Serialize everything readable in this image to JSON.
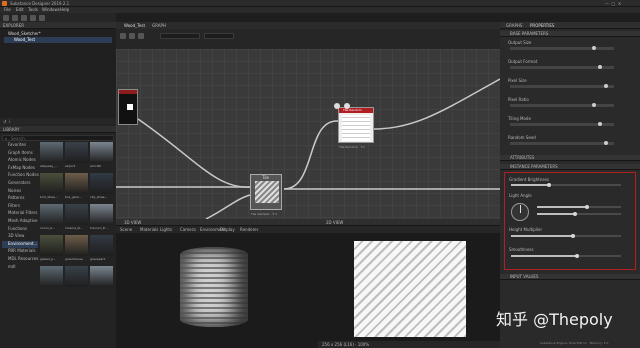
{
  "titlebar": {
    "title": "Substance Designer 2019.2.1"
  },
  "menubar": {
    "items": [
      "File",
      "Edit",
      "Tools",
      "Windows",
      "Help"
    ]
  },
  "explorer": {
    "title": "EXPLORER",
    "package": "Wood_Sketcher*",
    "graph": "Wood_Test"
  },
  "library": {
    "title": "LIBRARY",
    "search_placeholder": "Search",
    "categories": [
      "Favorites",
      "Graph Items",
      "Atomic Nodes",
      "FxMap Nodes",
      "Function Nodes",
      "Generators",
      "Noises",
      "Patterns",
      "Filters",
      "Material Filters",
      "Mesh Adaptive",
      "Functions",
      "3D View",
      "Environment...",
      "PBR Materials",
      "MDL Resources",
      "mdl"
    ],
    "thumbs": [
      "alleyway_...",
      "airport",
      "aircraft",
      "bird_stree...",
      "bus_gara...",
      "city_stree...",
      "circus_b...",
      "cinema_bi...",
      "Cannon_E...",
      "glazed_p...",
      "greenhouse",
      "gravepark",
      "",
      "",
      ""
    ]
  },
  "graph": {
    "tab": "Wood_Test",
    "tab2": "GRAPH",
    "main_node_title": "Tile",
    "main_node_caption": "Tile Sampler  -  T.1",
    "right_node_title": "Tile Random",
    "right_node_caption": "Tile Random  -  T.1"
  },
  "view3d": {
    "title": "3D VIEW",
    "menu": [
      "Scene",
      "Materials",
      "Lights",
      "Camera",
      "Environment",
      "Display",
      "Renderer"
    ]
  },
  "view2d": {
    "title": "2D VIEW",
    "status": "256 x 256 (L16)  ·  100%"
  },
  "properties": {
    "tab1": "GRAPHS",
    "tab2": "PROPERTIES",
    "section_base": "BASE PARAMETERS",
    "rows": [
      "Output Size",
      "Output Format",
      "Pixel Size",
      "Pixel Ratio",
      "Tiling Mode",
      "Random Seed"
    ],
    "section_attrs": "ATTRIBUTES",
    "section_inputs": "INSTANCE PARAMETERS",
    "highlighted": [
      "Gradient Brightness",
      "Light Angle",
      "Height Multiplier",
      "Smoothness"
    ],
    "section_footer": "INPUT VALUES",
    "bottom_status": "Substance Engine: Direct3D 11 · Memory: 1%"
  },
  "colors": {
    "accent_red": "#c8282d",
    "highlight_box": "#b02020"
  },
  "watermark": "知乎 @Thepoly"
}
